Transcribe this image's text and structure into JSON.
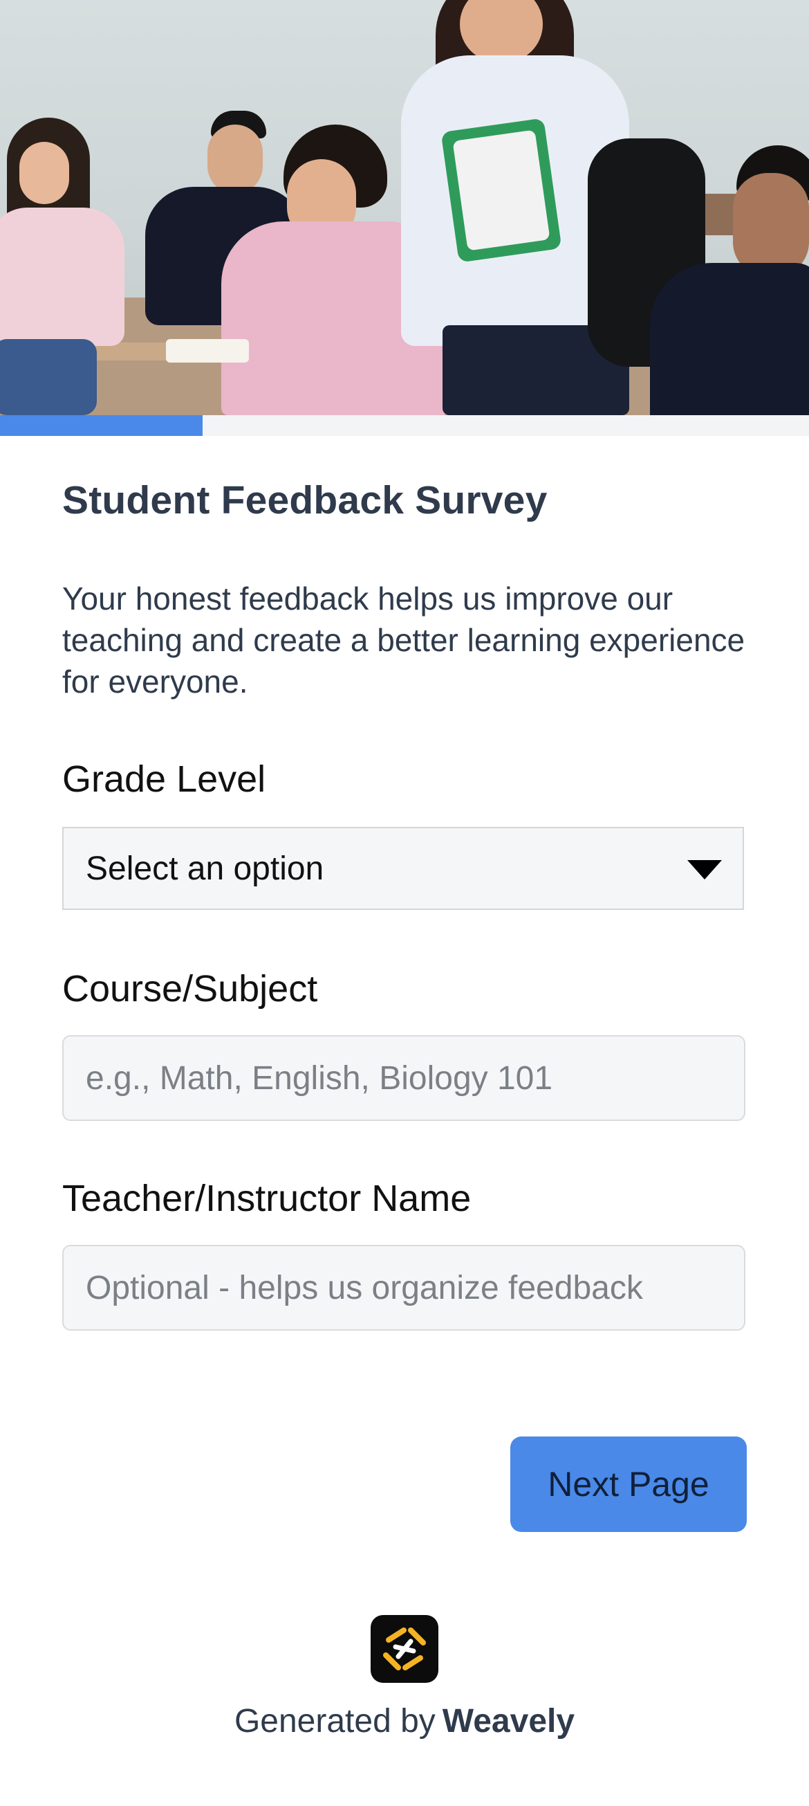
{
  "progress": {
    "percent": 25,
    "fill_color": "#4a89e8"
  },
  "form": {
    "title": "Student Feedback Survey",
    "description": "Your honest feedback helps us improve our teaching and create a better learning experience for everyone.",
    "fields": [
      {
        "label": "Grade Level",
        "type": "select",
        "value": "Select an option"
      },
      {
        "label": "Course/Subject",
        "type": "text",
        "value": "",
        "placeholder": "e.g., Math, English, Biology 101"
      },
      {
        "label": "Teacher/Instructor Name",
        "type": "text",
        "value": "",
        "placeholder": "Optional - helps us organize feedback"
      }
    ],
    "next_button_label": "Next Page"
  },
  "footer": {
    "generated_by": "Generated by",
    "brand": "Weavely",
    "logo_icon": "weavely-logo-icon"
  },
  "colors": {
    "accent": "#4a89e8",
    "text": "#2f3b4c",
    "logo_yellow": "#f5b324"
  }
}
